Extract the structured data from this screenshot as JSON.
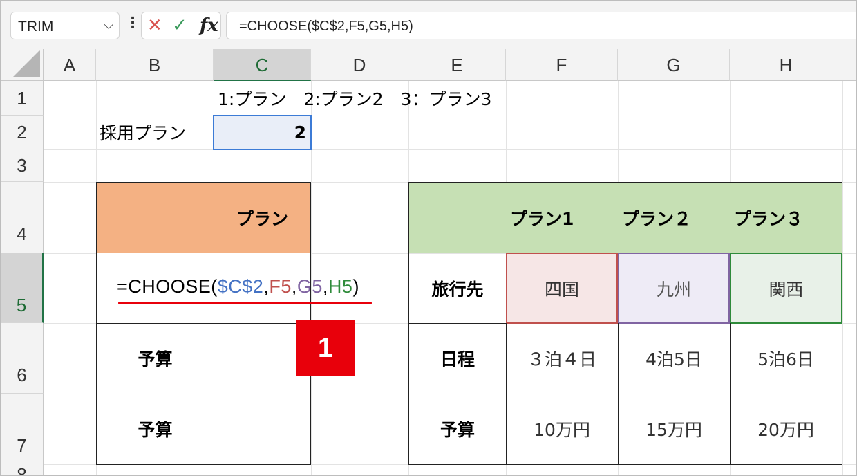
{
  "formula_bar": {
    "name_box": "TRIM",
    "formula": "=CHOOSE($C$2,F5,G5,H5)",
    "cancel_icon": "x-icon",
    "enter_icon": "check-icon",
    "function_icon": "fx-icon"
  },
  "columns": [
    "A",
    "B",
    "C",
    "D",
    "E",
    "F",
    "G",
    "H"
  ],
  "rows": [
    "1",
    "2",
    "3",
    "4",
    "5",
    "6",
    "7",
    "8"
  ],
  "cells": {
    "C1": "1:プラン　2:プラン2　3：プラン3",
    "B2": "採用プラン",
    "C2": "2",
    "C4": "プラン",
    "B5_formula": {
      "eq": "=CHOOSE(",
      "ref1": "$C$2",
      "c1": ",",
      "ref2": "F5",
      "c2": ",",
      "ref3": "G5",
      "c3": ",",
      "ref4": "H5",
      "close": ")"
    },
    "B6": "予算",
    "B7": "予算",
    "F4": "プラン1",
    "G4": "プラン２",
    "H4": "プラン３",
    "E5": "旅行先",
    "F5": "四国",
    "G5": "九州",
    "H5": "関西",
    "E6": "日程",
    "F6": "３泊４日",
    "G6": "4泊5日",
    "H6": "5泊6日",
    "E7": "予算",
    "F7": "10万円",
    "G7": "15万円",
    "H7": "20万円"
  },
  "step_badge": "1",
  "colors": {
    "orange_header": "#f4b183",
    "green_header": "#c6e0b4",
    "ref_blue": "#4472c4",
    "ref_red": "#c0504d",
    "ref_purple": "#8064a2",
    "ref_green": "#2e8b3a",
    "badge_red": "#e8000b"
  }
}
